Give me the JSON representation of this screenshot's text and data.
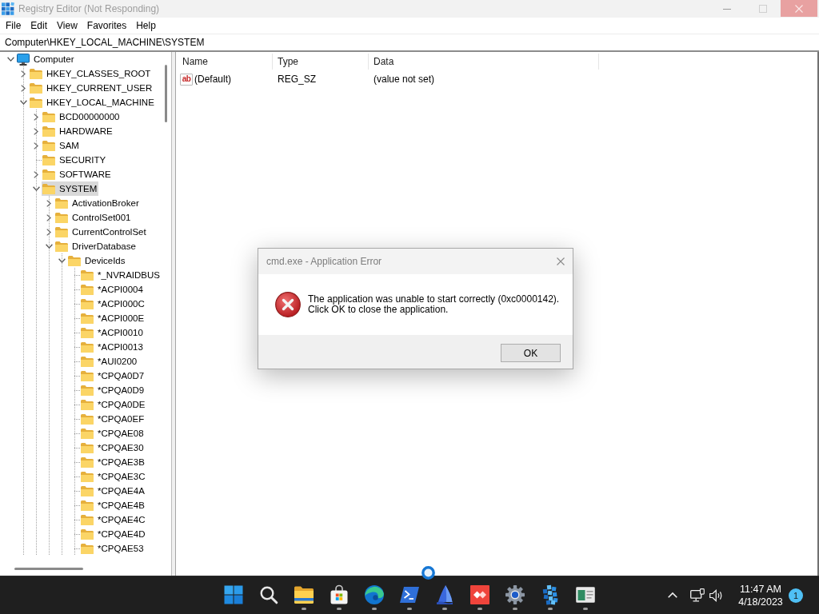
{
  "window": {
    "title": "Registry Editor (Not Responding)"
  },
  "menu": [
    "File",
    "Edit",
    "View",
    "Favorites",
    "Help"
  ],
  "address_bar": {
    "value": "Computer\\HKEY_LOCAL_MACHINE\\SYSTEM"
  },
  "tree": [
    {
      "kind": "computer",
      "label": "Computer",
      "expanded": true,
      "selected": false,
      "children": [
        {
          "kind": "key",
          "label": "HKEY_CLASSES_ROOT",
          "expanded": false,
          "selected": false
        },
        {
          "kind": "key",
          "label": "HKEY_CURRENT_USER",
          "expanded": false,
          "selected": false
        },
        {
          "kind": "key",
          "label": "HKEY_LOCAL_MACHINE",
          "expanded": true,
          "selected": false,
          "children": [
            {
              "kind": "key",
              "label": "BCD00000000",
              "expanded": false,
              "selected": false
            },
            {
              "kind": "key",
              "label": "HARDWARE",
              "expanded": false,
              "selected": false
            },
            {
              "kind": "key",
              "label": "SAM",
              "expanded": false,
              "selected": false
            },
            {
              "kind": "leaf",
              "label": "SECURITY",
              "selected": false
            },
            {
              "kind": "key",
              "label": "SOFTWARE",
              "expanded": false,
              "selected": false
            },
            {
              "kind": "key",
              "label": "SYSTEM",
              "expanded": true,
              "selected": true,
              "children": [
                {
                  "kind": "key",
                  "label": "ActivationBroker",
                  "expanded": false,
                  "selected": false
                },
                {
                  "kind": "key",
                  "label": "ControlSet001",
                  "expanded": false,
                  "selected": false
                },
                {
                  "kind": "key",
                  "label": "CurrentControlSet",
                  "expanded": false,
                  "selected": false
                },
                {
                  "kind": "key",
                  "label": "DriverDatabase",
                  "expanded": true,
                  "selected": false,
                  "children": [
                    {
                      "kind": "key",
                      "label": "DeviceIds",
                      "expanded": true,
                      "selected": false,
                      "children": [
                        {
                          "kind": "leaf",
                          "label": "*_NVRAIDBUS",
                          "selected": false
                        },
                        {
                          "kind": "leaf",
                          "label": "*ACPI0004",
                          "selected": false
                        },
                        {
                          "kind": "leaf",
                          "label": "*ACPI000C",
                          "selected": false
                        },
                        {
                          "kind": "leaf",
                          "label": "*ACPI000E",
                          "selected": false
                        },
                        {
                          "kind": "leaf",
                          "label": "*ACPI0010",
                          "selected": false
                        },
                        {
                          "kind": "leaf",
                          "label": "*ACPI0013",
                          "selected": false
                        },
                        {
                          "kind": "leaf",
                          "label": "*AUI0200",
                          "selected": false
                        },
                        {
                          "kind": "leaf",
                          "label": "*CPQA0D7",
                          "selected": false
                        },
                        {
                          "kind": "leaf",
                          "label": "*CPQA0D9",
                          "selected": false
                        },
                        {
                          "kind": "leaf",
                          "label": "*CPQA0DE",
                          "selected": false
                        },
                        {
                          "kind": "leaf",
                          "label": "*CPQA0EF",
                          "selected": false
                        },
                        {
                          "kind": "leaf",
                          "label": "*CPQAE08",
                          "selected": false
                        },
                        {
                          "kind": "leaf",
                          "label": "*CPQAE30",
                          "selected": false
                        },
                        {
                          "kind": "leaf",
                          "label": "*CPQAE3B",
                          "selected": false
                        },
                        {
                          "kind": "leaf",
                          "label": "*CPQAE3C",
                          "selected": false
                        },
                        {
                          "kind": "leaf",
                          "label": "*CPQAE4A",
                          "selected": false
                        },
                        {
                          "kind": "leaf",
                          "label": "*CPQAE4B",
                          "selected": false
                        },
                        {
                          "kind": "leaf",
                          "label": "*CPQAE4C",
                          "selected": false
                        },
                        {
                          "kind": "leaf",
                          "label": "*CPQAE4D",
                          "selected": false
                        },
                        {
                          "kind": "leaf",
                          "label": "*CPQAE53",
                          "selected": false
                        }
                      ]
                    }
                  ]
                }
              ]
            }
          ]
        }
      ]
    }
  ],
  "values_table": {
    "columns": [
      "Name",
      "Type",
      "Data"
    ],
    "rows": [
      {
        "icon_text": "ab",
        "name": "(Default)",
        "type": "REG_SZ",
        "data": "(value not set)"
      }
    ]
  },
  "dialog": {
    "title": "cmd.exe - Application Error",
    "message": "The application was unable to start correctly (0xc0000142). Click OK to close the application.",
    "buttons": [
      "OK"
    ]
  },
  "taskbar": {
    "apps": [
      {
        "kind": "start",
        "running": false
      },
      {
        "kind": "search",
        "running": false
      },
      {
        "kind": "explorer",
        "running": true
      },
      {
        "kind": "store",
        "running": true
      },
      {
        "kind": "browser",
        "running": true
      },
      {
        "kind": "terminal",
        "running": true
      },
      {
        "kind": "sail",
        "running": true
      },
      {
        "kind": "remote",
        "running": true
      },
      {
        "kind": "settings",
        "running": true
      },
      {
        "kind": "cubes",
        "running": true
      },
      {
        "kind": "viewer",
        "running": true
      }
    ],
    "clock": {
      "time": "11:47 AM",
      "date": "4/18/2023"
    },
    "notification_count": "1"
  }
}
